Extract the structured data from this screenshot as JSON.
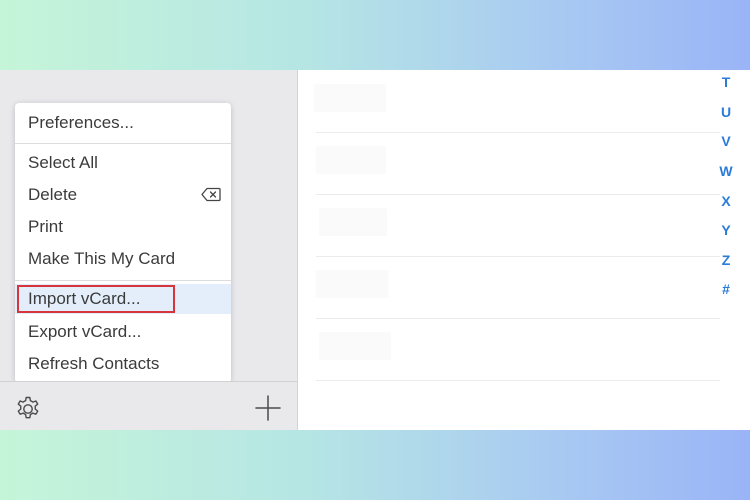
{
  "menu": {
    "items": [
      {
        "label": "Preferences..."
      },
      {
        "label": "Select All"
      },
      {
        "label": "Delete",
        "shortcut_icon": "delete-key-icon"
      },
      {
        "label": "Print"
      },
      {
        "label": "Make This My Card"
      },
      {
        "label": "Import vCard...",
        "highlighted": true
      },
      {
        "label": "Export vCard..."
      },
      {
        "label": "Refresh Contacts"
      }
    ]
  },
  "footer": {
    "settings_icon": "gear-icon",
    "add_icon": "plus-icon"
  },
  "index_letters": [
    "T",
    "U",
    "V",
    "W",
    "X",
    "Y",
    "Z",
    "#"
  ],
  "colors": {
    "index_blue": "#2b7bd8",
    "highlight_outline": "#d6353c",
    "sidebar_bg": "#e9e9ec"
  }
}
